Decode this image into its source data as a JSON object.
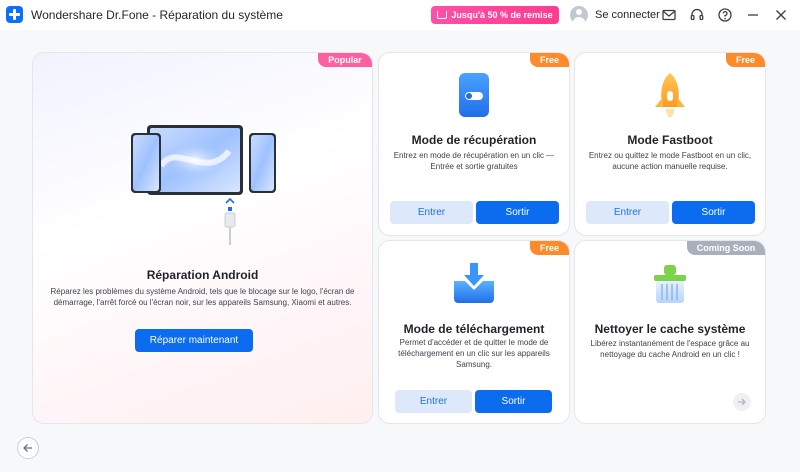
{
  "titlebar": {
    "app_title": "Wondershare Dr.Fone - Réparation du système",
    "promo_label": "Jusqu'à 50 % de remise",
    "login_label": "Se connecter",
    "icons": [
      "mail-icon",
      "headset-icon",
      "help-icon",
      "minimize-icon",
      "close-icon"
    ]
  },
  "cards": {
    "android": {
      "badge": "Popular",
      "title": "Réparation Android",
      "description": "Réparez les problèmes du système Android, tels que le blocage sur le logo, l'écran de démarrage, l'arrêt forcé ou l'écran noir, sur les appareils Samsung, Xiaomi et autres.",
      "button": "Réparer maintenant"
    },
    "recovery": {
      "badge": "Free",
      "title": "Mode de récupération",
      "description": "Entrez en mode de récupération en un clic — Entrée et sortie gratuites",
      "enter": "Entrer",
      "exit": "Sortir"
    },
    "fastboot": {
      "badge": "Free",
      "title": "Mode Fastboot",
      "description": "Entrez ou quittez le mode Fastboot en un clic, aucune action manuelle requise.",
      "enter": "Entrer",
      "exit": "Sortir"
    },
    "download": {
      "badge": "Free",
      "title": "Mode de téléchargement",
      "description": "Permet d'accéder et de quitter le mode de téléchargement en un clic sur les appareils Samsung.",
      "enter": "Entrer",
      "exit": "Sortir"
    },
    "cache": {
      "badge": "Coming Soon",
      "title": "Nettoyer le cache système",
      "description": "Libérez instantanément de l'espace grâce au nettoyage du cache Android en un clic !"
    }
  },
  "colors": {
    "accent": "#0b6cf0",
    "popular": "#ff5fa0",
    "free": "#ff8a2a",
    "coming_soon": "#a9b0bc"
  }
}
